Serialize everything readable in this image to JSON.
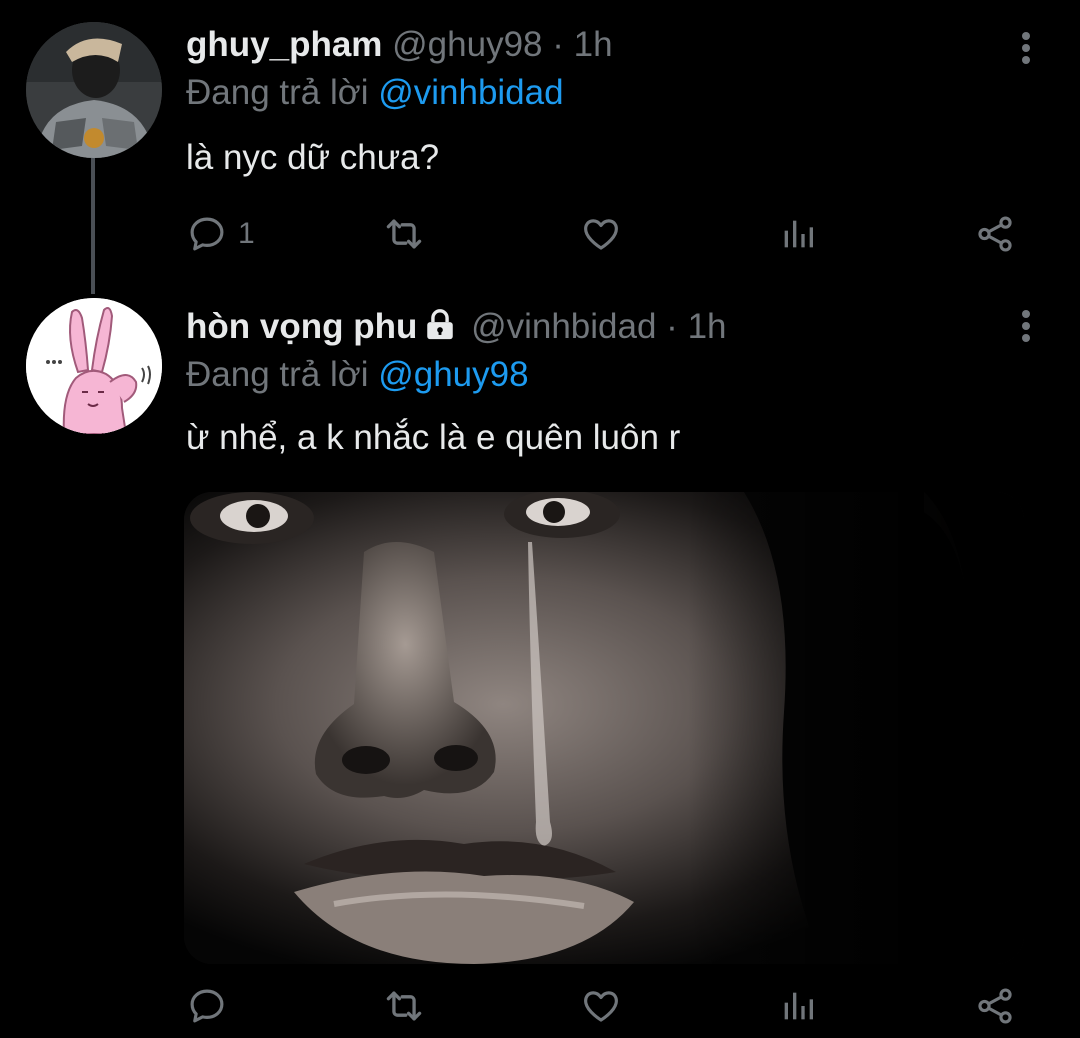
{
  "tweets": [
    {
      "display_name": "ghuy_pham",
      "handle": "@ghuy98",
      "separator": "·",
      "time": "1h",
      "reply_prefix": "Đang trả lời",
      "reply_to": "@vinhbidad",
      "text": "là nyc dữ chưa?",
      "reply_count": "1",
      "locked": false
    },
    {
      "display_name": "hòn vọng phu",
      "handle": "@vinhbidad",
      "separator": "·",
      "time": "1h",
      "reply_prefix": "Đang trả lời",
      "reply_to": "@ghuy98",
      "text": "ừ nhể, a k nhắc là e quên luôn r",
      "reply_count": "",
      "locked": true
    }
  ],
  "icons": {
    "reply": "comment-icon",
    "retweet": "retweet-icon",
    "like": "heart-icon",
    "analytics": "analytics-icon",
    "share": "share-icon",
    "more": "more-vertical-icon",
    "lock": "lock-icon"
  },
  "colors": {
    "background": "#000000",
    "primary_text": "#e7e9ea",
    "secondary_text": "#71767b",
    "accent": "#1d9bf0",
    "thread_line": "#4a4f55"
  }
}
